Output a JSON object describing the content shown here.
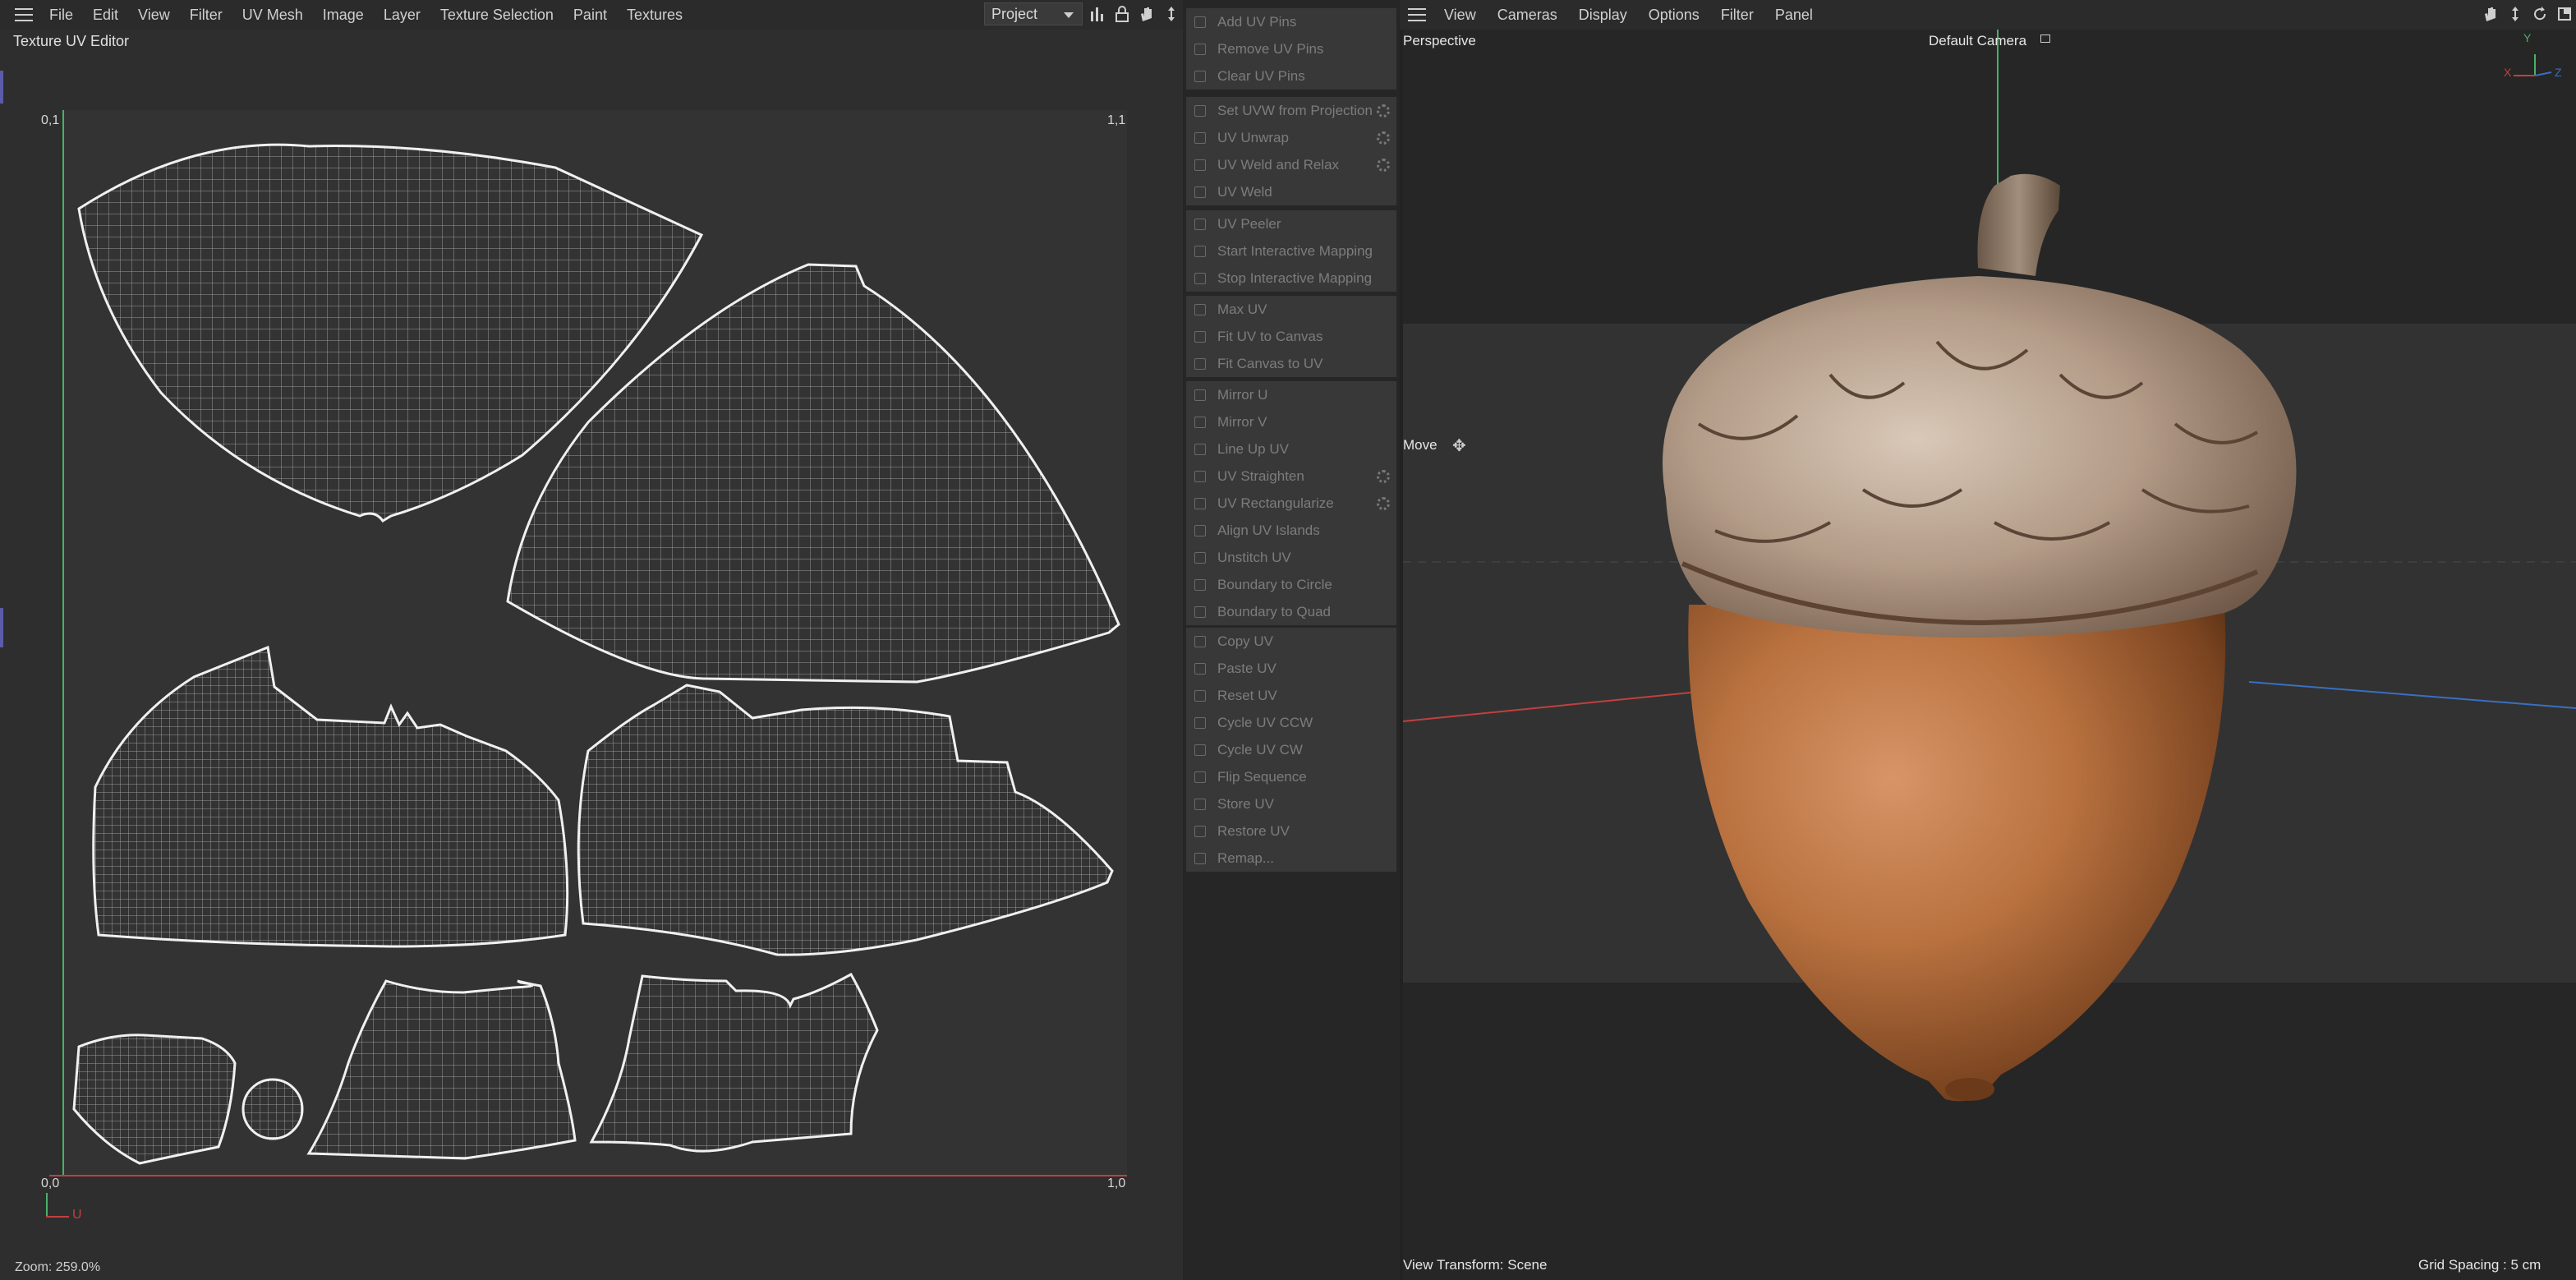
{
  "uv_editor": {
    "menu": [
      "File",
      "Edit",
      "View",
      "Filter",
      "UV Mesh",
      "Image",
      "Layer",
      "Texture Selection",
      "Paint",
      "Textures"
    ],
    "title": "Texture UV Editor",
    "project_select": "Project",
    "corners": {
      "top_left": "0,1",
      "top_right": "1,1",
      "bottom_left": "0,0",
      "bottom_right": "1,0"
    },
    "axis_u": "U",
    "zoom": "Zoom: 259.0%"
  },
  "uv_commands": {
    "groups": [
      [
        {
          "label": "Add UV Pins"
        },
        {
          "label": "Remove UV Pins"
        },
        {
          "label": "Clear UV Pins"
        }
      ],
      [
        {
          "label": "Set UVW from Projection",
          "gear": true
        },
        {
          "label": "UV Unwrap",
          "gear": true
        },
        {
          "label": "UV Weld and Relax",
          "gear": true
        },
        {
          "label": "UV Weld"
        }
      ],
      [
        {
          "label": "UV Peeler"
        },
        {
          "label": "Start Interactive Mapping"
        },
        {
          "label": "Stop Interactive Mapping"
        }
      ],
      [
        {
          "label": "Max UV"
        },
        {
          "label": "Fit UV to Canvas"
        },
        {
          "label": "Fit Canvas to UV"
        }
      ],
      [
        {
          "label": "Mirror U"
        },
        {
          "label": "Mirror V"
        },
        {
          "label": "Line Up UV"
        },
        {
          "label": "UV Straighten",
          "gear": true
        },
        {
          "label": "UV Rectangularize",
          "gear": true
        },
        {
          "label": "Align UV Islands"
        },
        {
          "label": "Unstitch UV"
        },
        {
          "label": "Boundary to Circle"
        },
        {
          "label": "Boundary to Quad"
        }
      ],
      [
        {
          "label": "Copy UV"
        },
        {
          "label": "Paste UV"
        },
        {
          "label": "Reset UV"
        },
        {
          "label": "Cycle UV CCW"
        },
        {
          "label": "Cycle UV CW"
        },
        {
          "label": "Flip Sequence"
        },
        {
          "label": "Store UV"
        },
        {
          "label": "Restore UV"
        },
        {
          "label": "Remap..."
        }
      ]
    ]
  },
  "viewport": {
    "menu": [
      "View",
      "Cameras",
      "Display",
      "Options",
      "Filter",
      "Panel"
    ],
    "projection": "Perspective",
    "camera": "Default Camera",
    "tool": "Move",
    "view_transform": "View Transform: Scene",
    "grid_spacing": "Grid Spacing : 5 cm",
    "axes": {
      "x": "X",
      "y": "Y",
      "z": "Z"
    }
  },
  "colors": {
    "accent_green": "#4caf6a",
    "axis_red": "#c04040",
    "axis_blue": "#3a6fc0"
  }
}
